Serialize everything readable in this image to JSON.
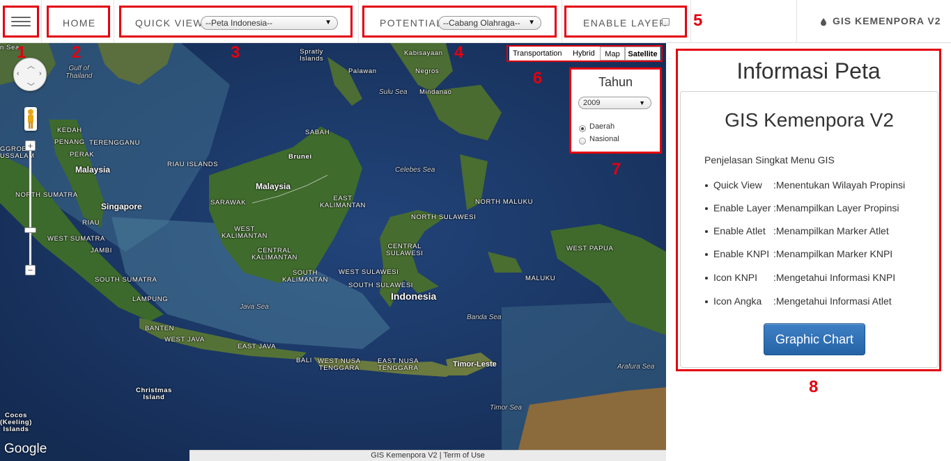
{
  "navbar": {
    "home_label": "HOME",
    "quick_view_label": "QUICK VIEW",
    "quick_view_selected": "--Peta Indonesia--",
    "potential_label": "POTENTIAL",
    "potential_selected": "--Cabang Olahraga--",
    "enable_layer_label": "ENABLE LAYER",
    "enable_layer_checked": false,
    "brand_icon": "droplet-icon",
    "brand_label": "GIS KEMENPORA V2"
  },
  "annotation_numbers": [
    "1",
    "2",
    "3",
    "4",
    "5",
    "6",
    "7",
    "8"
  ],
  "map": {
    "map_types": [
      "Transportation",
      "Hybrid",
      "Map",
      "Satellite"
    ],
    "active_map_type": "Satellite",
    "tahun_panel": {
      "title": "Tahun",
      "year_selected": "2009",
      "options": [
        "Daerah",
        "Nasional"
      ],
      "selected_option": "Daerah"
    },
    "labels": {
      "gulf_of_thailand": "Gulf of\nThailand",
      "spratly": "Spratly\nIslands",
      "kabisayaan": "Kabisayaan",
      "palawan": "Palawan",
      "negros": "Negros",
      "sulu_sea": "Sulu Sea",
      "mindanao": "Mindanao",
      "kedah": "KEDAH",
      "penang": "PENANG",
      "terengganu": "TERENGGANU",
      "perak": "PERAK",
      "malaysia_west": "Malaysia",
      "sabah": "SABAH",
      "brunei": "Brunei",
      "riau_islands": "RIAU ISLANDS",
      "north_sumatra": "NORTH SUMATRA",
      "singapore": "Singapore",
      "malaysia_east": "Malaysia",
      "sarawak": "SARAWAK",
      "east_kalimantan": "EAST\nKALIMANTAN",
      "celebes_sea": "Celebes Sea",
      "north_maluku": "NORTH MALUKU",
      "riau": "RIAU",
      "west_kalimantan": "WEST\nKALIMANTAN",
      "north_sulawesi": "NORTH SULAWESI",
      "west_sumatra": "WEST SUMATRA",
      "jambi": "JAMBI",
      "central_kalimantan": "CENTRAL\nKALIMANTAN",
      "central_sulawesi": "CENTRAL\nSULAWESI",
      "west_papua": "WEST PAPUA",
      "south_sumatra": "SOUTH SUMATRA",
      "south_kalimantan": "SOUTH\nKALIMANTAN",
      "west_sulawesi": "WEST SULAWESI",
      "south_sulawesi": "SOUTH SULAWESI",
      "maluku": "MALUKU",
      "indonesia": "Indonesia",
      "lampung": "LAMPUNG",
      "java_sea": "Java Sea",
      "banda_sea": "Banda Sea",
      "banten": "BANTEN",
      "west_java": "WEST JAVA",
      "east_java": "EAST JAVA",
      "bali": "BALI",
      "west_nusa_tenggara": "WEST NUSA\nTENGGARA",
      "east_nusa_tenggara": "EAST NUSA\nTENGGARA",
      "timor_leste": "Timor-Leste",
      "arafura_sea": "Arafura Sea",
      "christmas_island": "Christmas\nIsland",
      "timor_sea": "Timor Sea",
      "cocos": "Cocos\n(Keeling)\nIslands",
      "sroggre": "GGROE H\nUSSALAM",
      "n_sea_left": "n Sea"
    },
    "google_logo": "Google",
    "footer": "GIS Kemenpora V2 | Term of Use"
  },
  "info": {
    "title": "Informasi Peta",
    "card_title": "GIS Kemenpora V2",
    "desc_title": "Penjelasan Singkat Menu GIS",
    "items": [
      {
        "name": "Quick View",
        "desc": ":Menentukan Wilayah Propinsi"
      },
      {
        "name": "Enable Layer",
        "desc": ":Menampilkan Layer Propinsi"
      },
      {
        "name": "Enable Atlet",
        "desc": ":Menampilkan Marker Atlet"
      },
      {
        "name": "Enable KNPI",
        "desc": ":Menampilkan Marker KNPI"
      },
      {
        "name": "Icon KNPI",
        "desc": ":Mengetahui Informasi KNPI"
      },
      {
        "name": "Icon Angka",
        "desc": ":Mengetahui Informasi Atlet"
      }
    ],
    "chart_button": "Graphic Chart"
  }
}
